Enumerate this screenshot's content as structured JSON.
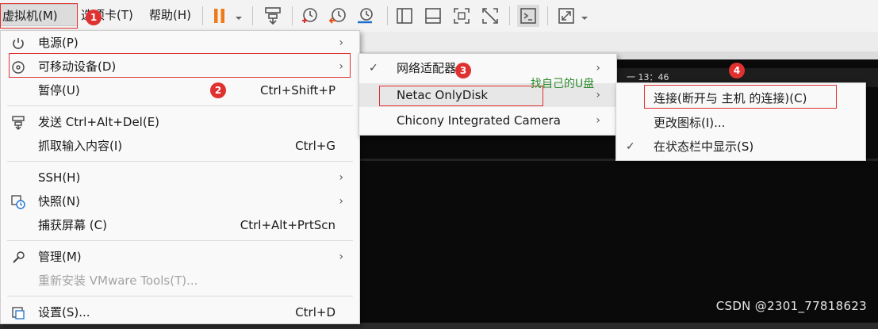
{
  "menubar": {
    "vm_label": "虚拟机(M)",
    "tabs_label": "选项卡(T)",
    "help_label": "帮助(H)"
  },
  "vm_menu": {
    "items": [
      {
        "label": "电源(P)",
        "shortcut": "",
        "submenu": true
      },
      {
        "label": "可移动设备(D)",
        "shortcut": "",
        "submenu": true
      },
      {
        "label": "暂停(U)",
        "shortcut": "Ctrl+Shift+P",
        "submenu": false
      },
      {
        "label": "发送 Ctrl+Alt+Del(E)",
        "shortcut": "",
        "submenu": false
      },
      {
        "label": "抓取输入内容(I)",
        "shortcut": "Ctrl+G",
        "submenu": false
      },
      {
        "label": "SSH(H)",
        "shortcut": "",
        "submenu": true
      },
      {
        "label": "快照(N)",
        "shortcut": "",
        "submenu": true
      },
      {
        "label": "捕获屏幕 (C)",
        "shortcut": "Ctrl+Alt+PrtScn",
        "submenu": false
      },
      {
        "label": "管理(M)",
        "shortcut": "",
        "submenu": true
      },
      {
        "label": "重新安装 VMware Tools(T)...",
        "shortcut": "",
        "submenu": false,
        "disabled": true
      },
      {
        "label": "设置(S)...",
        "shortcut": "Ctrl+D",
        "submenu": false
      }
    ]
  },
  "devices_menu": {
    "items": [
      {
        "label": "网络适配器",
        "checked": true,
        "submenu": true
      },
      {
        "label": "Netac OnlyDisk",
        "checked": false,
        "submenu": true
      },
      {
        "label": "Chicony Integrated Camera",
        "checked": false,
        "submenu": true
      }
    ]
  },
  "disk_menu": {
    "items": [
      {
        "label": "连接(断开与 主机 的连接)(C)",
        "checked": false
      },
      {
        "label": "更改图标(I)...",
        "checked": false
      },
      {
        "label": "在状态栏中显示(S)",
        "checked": true
      }
    ]
  },
  "annotations": {
    "badges": [
      "1",
      "2",
      "3",
      "4"
    ],
    "note": "找自己的U盘"
  },
  "console": {
    "clock_text": "一 13：46"
  },
  "watermark": "CSDN @2301_77818623",
  "glyphs": {
    "arrow": "›",
    "check": "✓"
  },
  "colors": {
    "accent_pause": "#f07a1a",
    "accent_blue": "#1e6fd0",
    "annotation_red": "#e03131",
    "annotation_green": "#2e8b2e"
  }
}
